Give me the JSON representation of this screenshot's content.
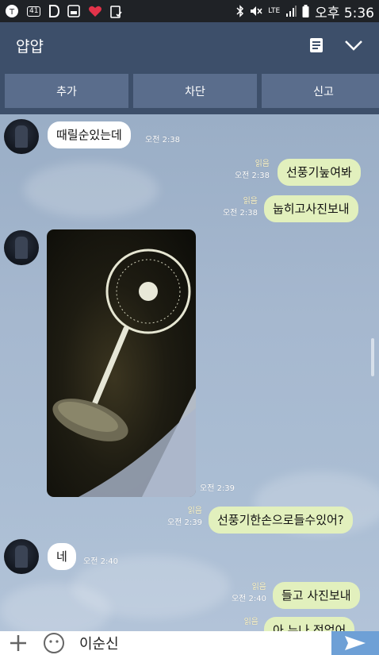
{
  "status_bar": {
    "badge": "41",
    "network": "LTE",
    "time": "오후 5:36"
  },
  "header": {
    "title": "얍얍"
  },
  "actions": [
    "추가",
    "차단",
    "신고"
  ],
  "messages": [
    {
      "text": "때릴순있는데",
      "time": "오전 2:38"
    },
    {
      "text": "선풍기눞여봐",
      "read": "읽음",
      "time": "오전 2:38"
    },
    {
      "text": "눕히고사진보내",
      "read": "읽음",
      "time": "오전 2:38"
    },
    {
      "time": "오전 2:39"
    },
    {
      "text": "선풍기한손으로들수있어?",
      "read": "읽음",
      "time": "오전 2:39"
    },
    {
      "text": "네",
      "time": "오전 2:40"
    },
    {
      "text": "들고 사진보내",
      "read": "읽음",
      "time": "오전 2:40"
    },
    {
      "text": "아 누나 정없어",
      "read": "읽음"
    }
  ],
  "input": {
    "value": "이순신"
  }
}
